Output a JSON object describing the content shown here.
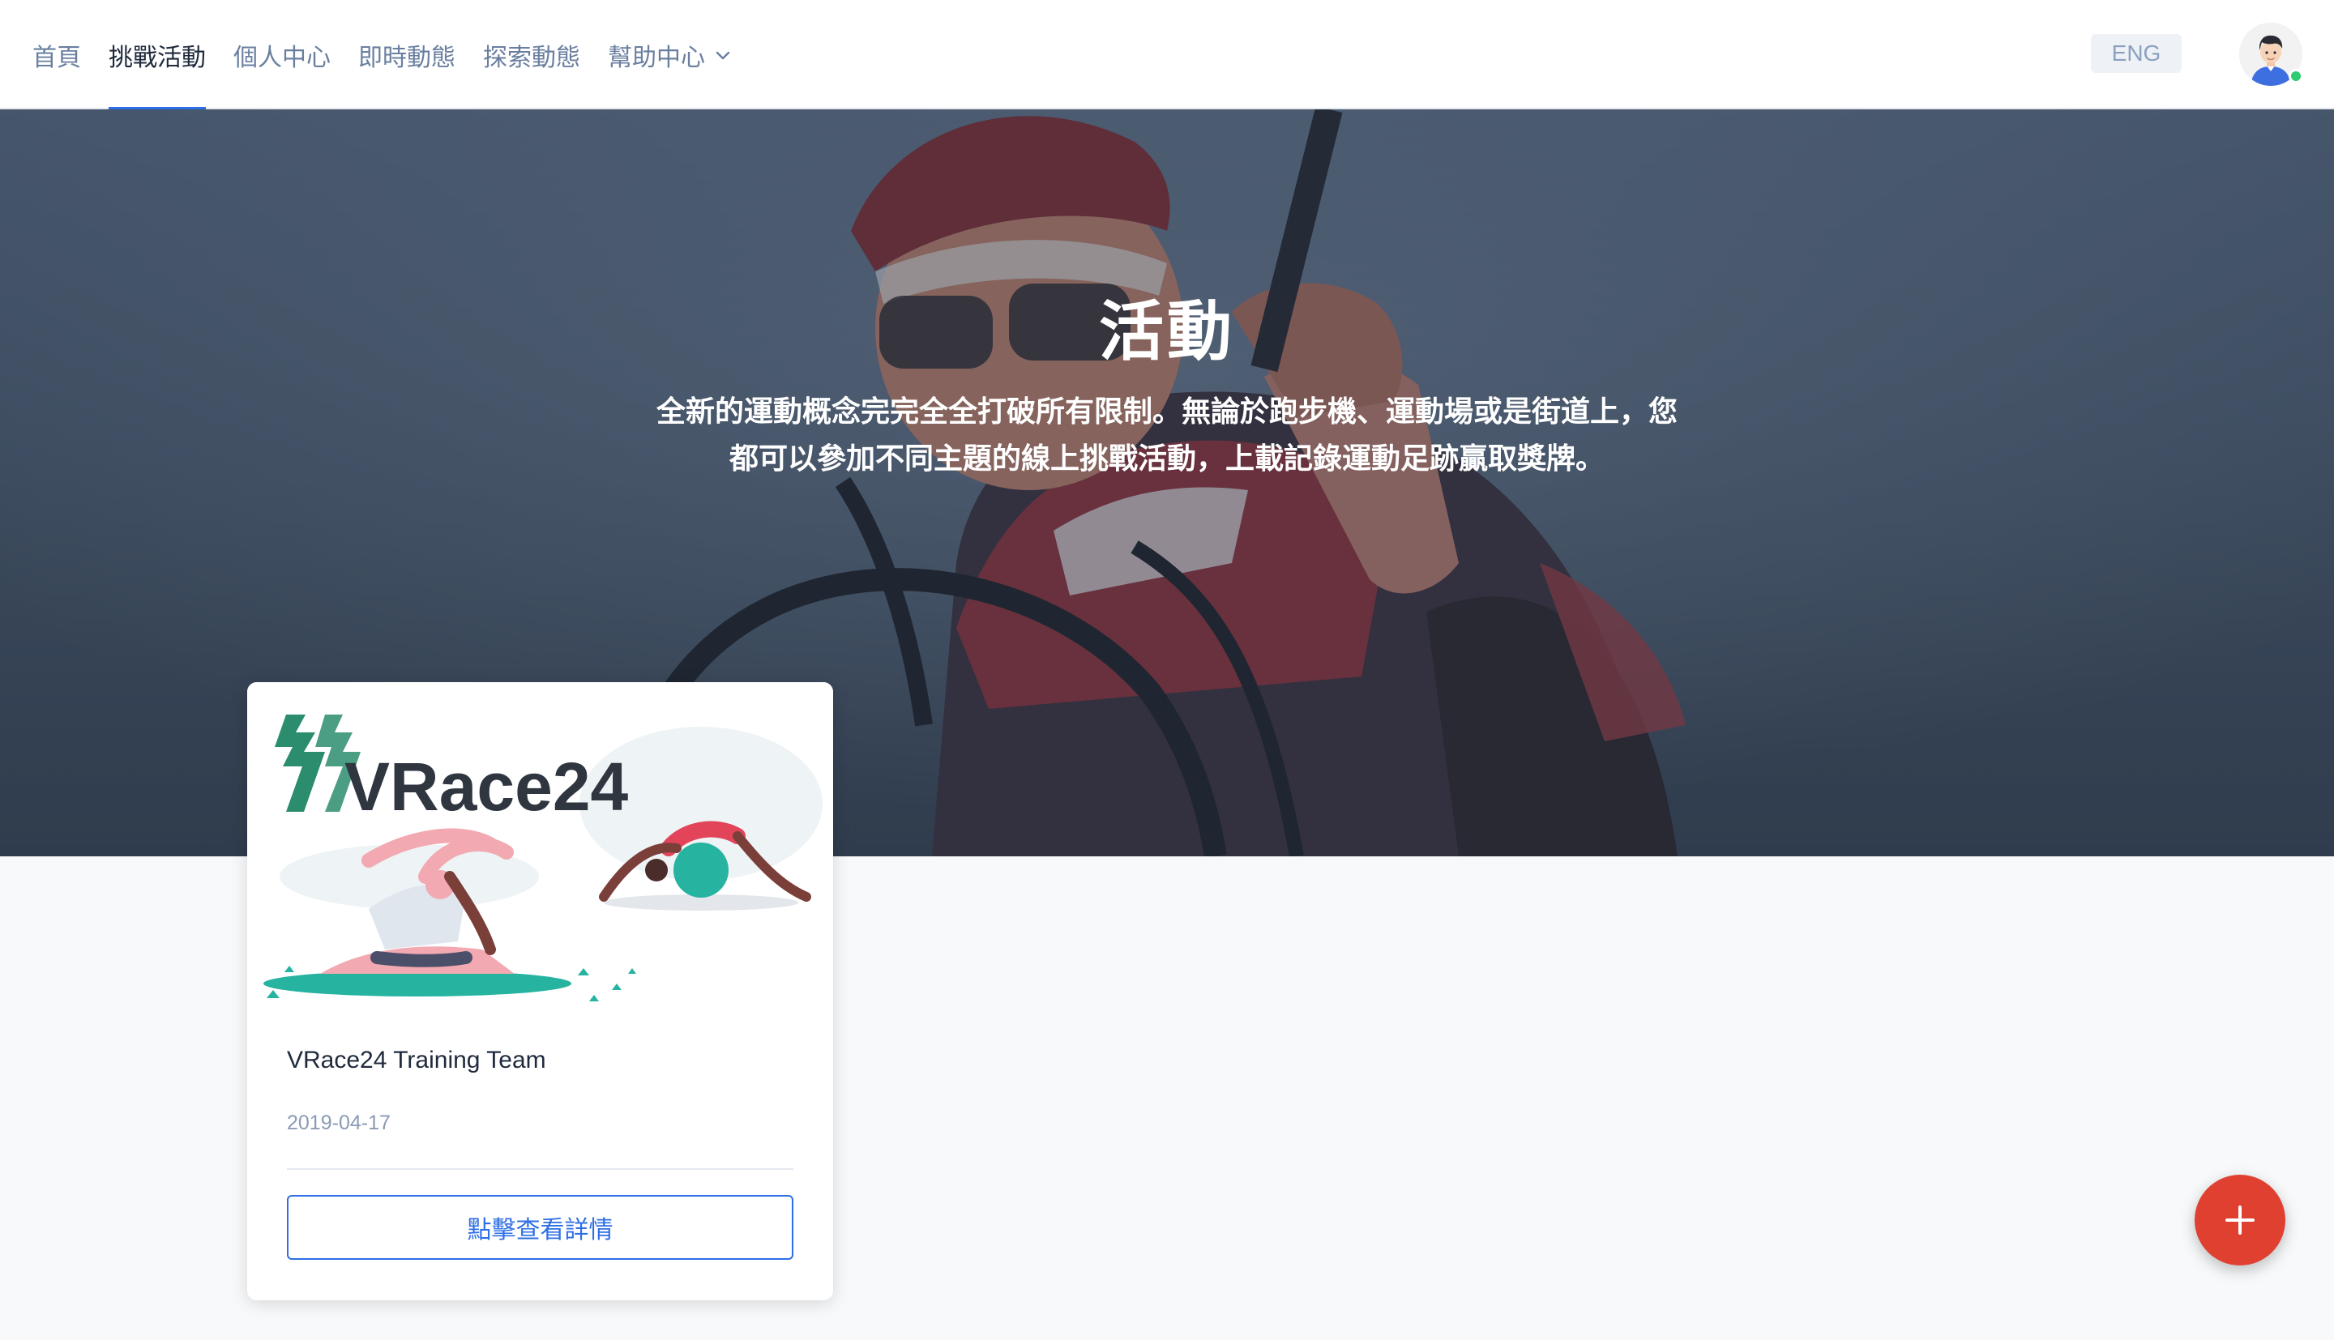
{
  "nav": {
    "items": [
      {
        "label": "首頁",
        "active": false
      },
      {
        "label": "挑戰活動",
        "active": true
      },
      {
        "label": "個人中心",
        "active": false
      },
      {
        "label": "即時動態",
        "active": false
      },
      {
        "label": "探索動態",
        "active": false
      },
      {
        "label": "幫助中心",
        "active": false,
        "has_dropdown": true
      }
    ],
    "language_label": "ENG"
  },
  "hero": {
    "title": "活動",
    "description_line1": "全新的運動概念完完全全打破所有限制。無論於跑步機、運動場或是街道上，您",
    "description_line2": "都可以參加不同主題的線上挑戰活動，上載記錄運動足跡贏取獎牌。"
  },
  "cards": [
    {
      "logo_text": "VRace24",
      "title": "VRace24 Training Team",
      "date": "2019-04-17",
      "button_label": "點擊查看詳情"
    }
  ],
  "colors": {
    "accent": "#2e6ee6",
    "fab": "#e0402f",
    "nav_text": "#6a7fa0",
    "nav_active": "#1f2a3c",
    "online": "#2ecc71",
    "logo_green": "#2b8c6e"
  },
  "icons": {
    "fab": "plus-icon",
    "dropdown": "chevron-down-icon"
  }
}
